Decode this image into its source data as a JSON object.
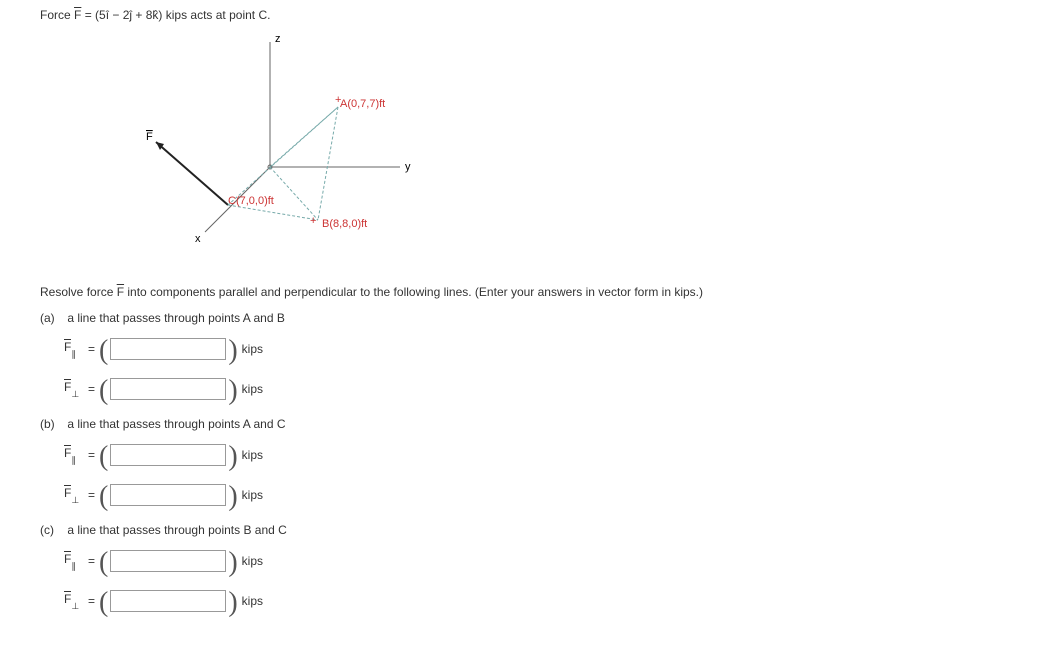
{
  "problem": {
    "prefix": "Force ",
    "force_symbol": "F",
    "force_expr": " = (5î − 2ĵ + 8k̂) kips acts at point C."
  },
  "diagram": {
    "z_label": "z",
    "y_label": "y",
    "x_label": "x",
    "F_label": "F",
    "A_label": "A(0,7,7)ft",
    "B_label": "B(8,8,0)ft",
    "C_label": "C(7,0,0)ft"
  },
  "instructions": {
    "prefix": "Resolve force ",
    "force_symbol": "F",
    "suffix": " into components parallel and perpendicular to the following lines. (Enter your answers in vector form in kips.)"
  },
  "parts": {
    "a": {
      "label": "(a)",
      "desc": "a line that passes through points A and B"
    },
    "b": {
      "label": "(b)",
      "desc": "a line that passes through points A and C"
    },
    "c": {
      "label": "(c)",
      "desc": "a line that passes through points B and C"
    }
  },
  "symbols": {
    "F": "F",
    "par_sub": "∥",
    "perp_sub": "⊥",
    "equals": "=",
    "unit": "kips"
  }
}
